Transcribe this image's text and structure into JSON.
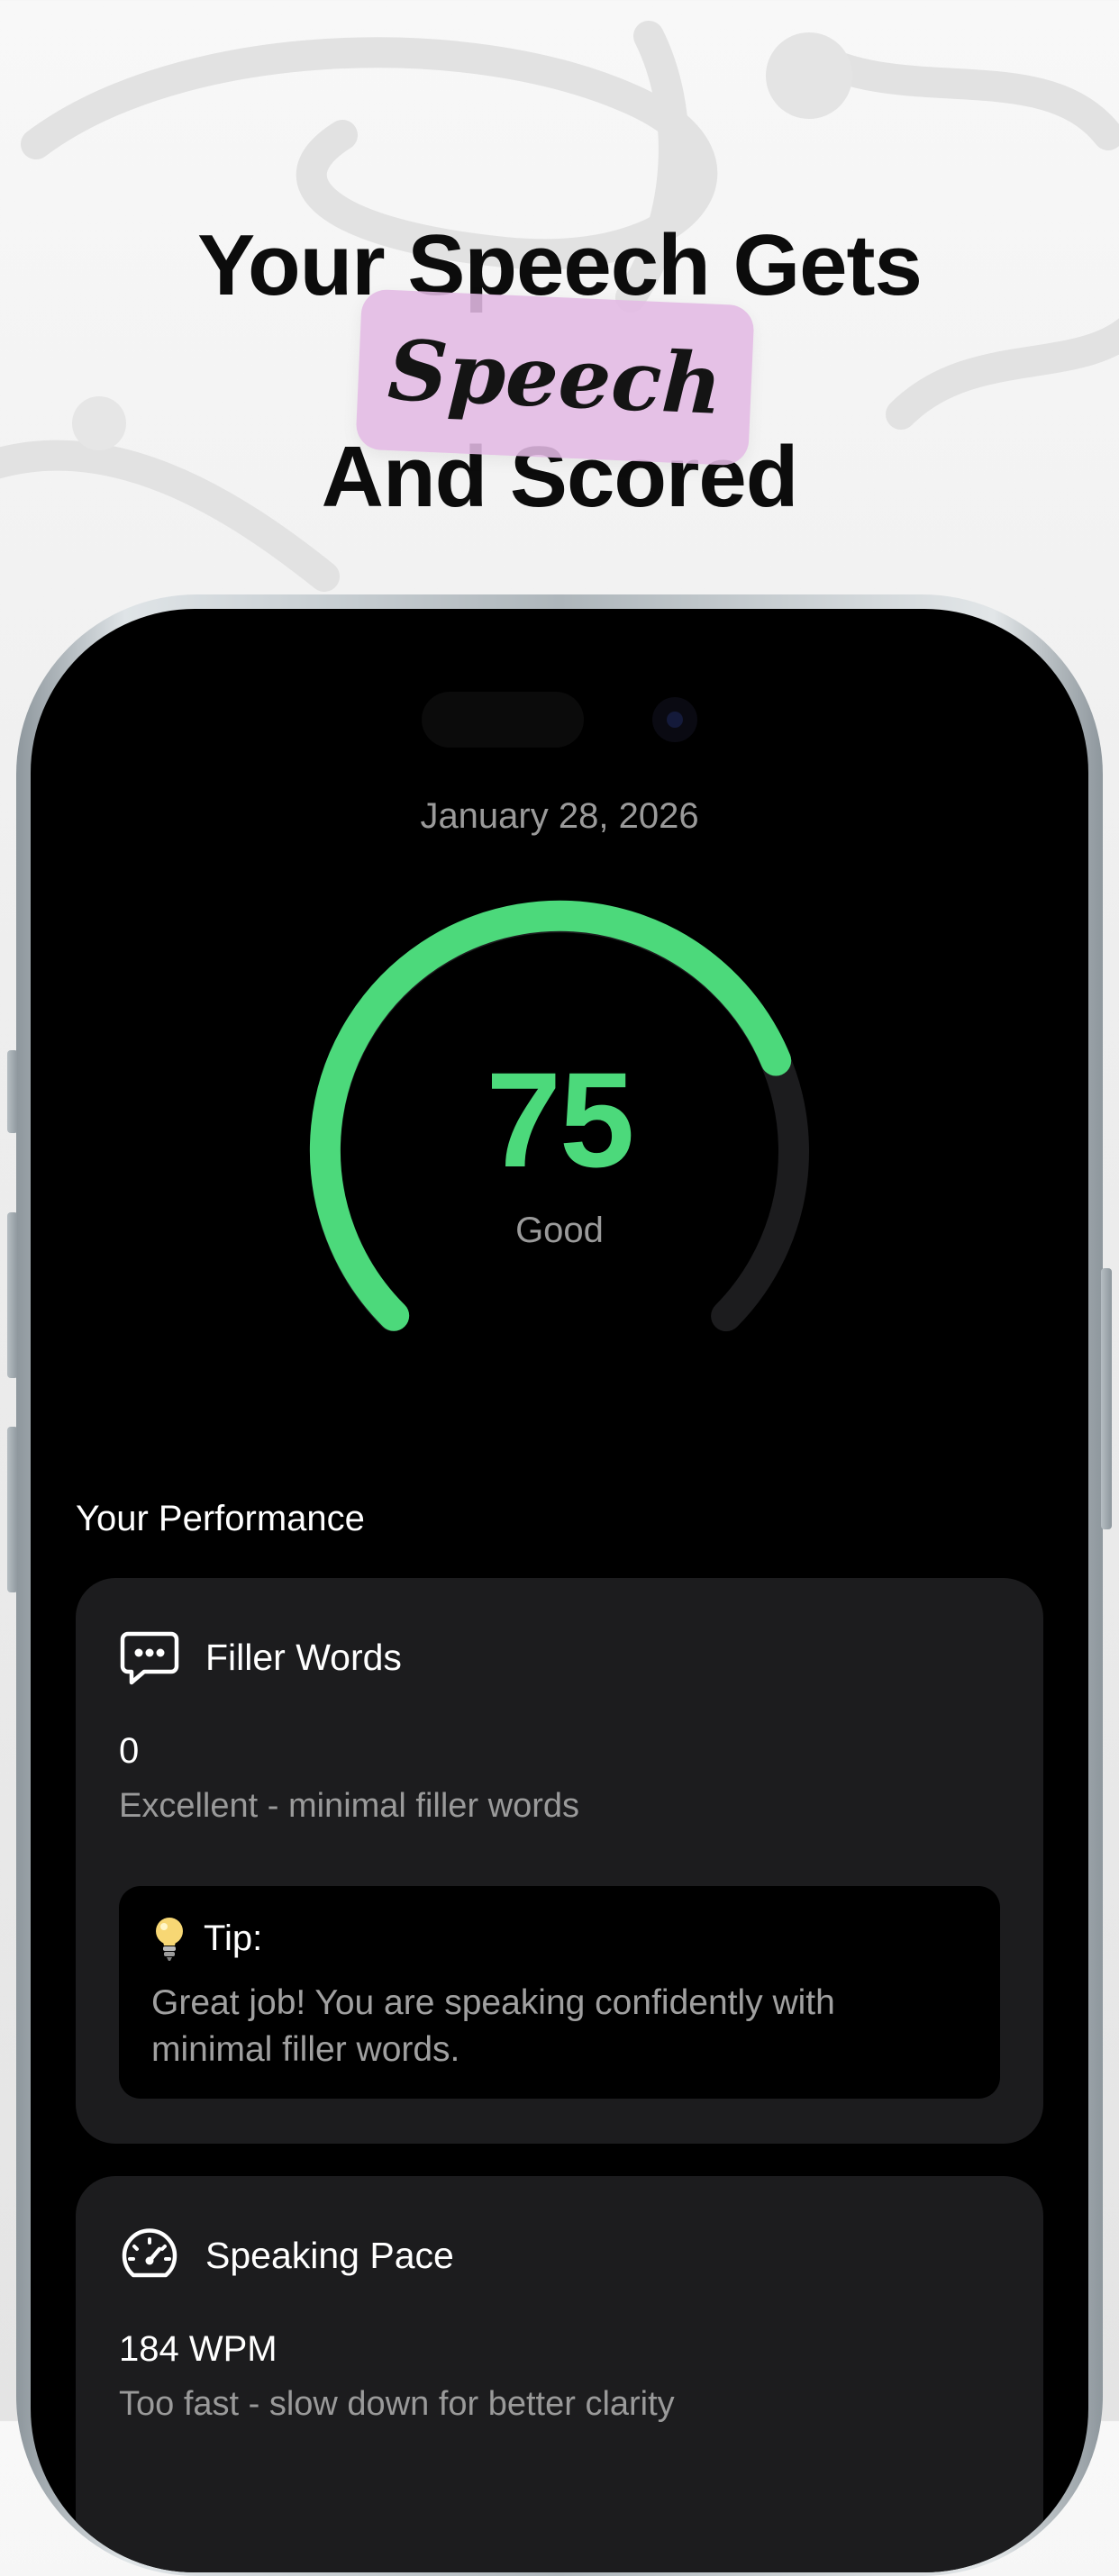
{
  "headline": {
    "line1": "Your Speech Gets",
    "sticker": "Speech",
    "line2": "And Scored"
  },
  "session": {
    "date": "January 28, 2026",
    "score": "75",
    "score_fraction": 0.75,
    "score_label": "Good",
    "accent_color": "#4cd97b"
  },
  "performance": {
    "section_title": "Your Performance",
    "filler": {
      "icon": "chat-bubble-icon",
      "title": "Filler Words",
      "value": "0",
      "description": "Excellent - minimal filler words",
      "tip_icon": "lightbulb-icon",
      "tip_label": "Tip:",
      "tip_text": "Great job! You are speaking confidently with minimal filler words."
    },
    "pace": {
      "icon": "speedometer-icon",
      "title": "Speaking Pace",
      "value": "184 WPM",
      "description": "Too fast - slow down for better clarity"
    }
  }
}
